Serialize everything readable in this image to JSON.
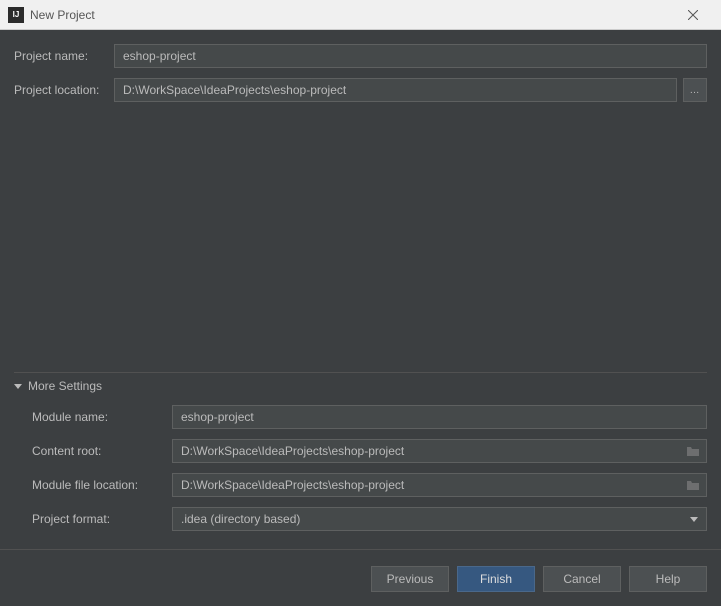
{
  "window": {
    "title": "New Project"
  },
  "top_form": {
    "project_name_label": "Project name:",
    "project_name_value": "eshop-project",
    "project_location_label": "Project location:",
    "project_location_value": "D:\\WorkSpace\\IdeaProjects\\eshop-project"
  },
  "more_settings": {
    "header": "More Settings",
    "module_name_label": "Module name:",
    "module_name_value": "eshop-project",
    "content_root_label": "Content root:",
    "content_root_value": "D:\\WorkSpace\\IdeaProjects\\eshop-project",
    "module_file_location_label": "Module file location:",
    "module_file_location_value": "D:\\WorkSpace\\IdeaProjects\\eshop-project",
    "project_format_label": "Project format:",
    "project_format_value": ".idea (directory based)"
  },
  "buttons": {
    "previous": "Previous",
    "finish": "Finish",
    "cancel": "Cancel",
    "help": "Help"
  }
}
